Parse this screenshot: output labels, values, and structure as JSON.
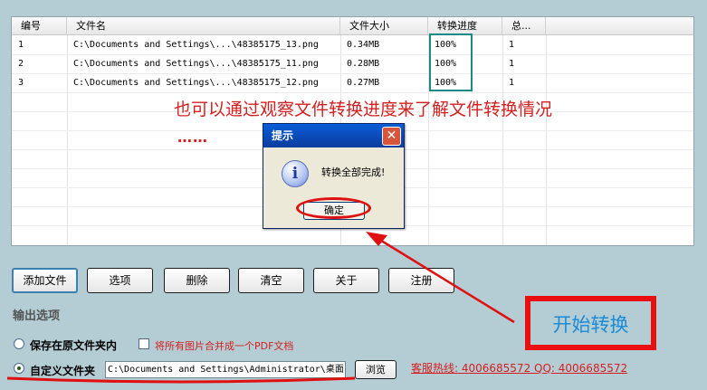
{
  "list": {
    "headers": [
      "编号",
      "文件名",
      "文件大小",
      "转换进度",
      "总..."
    ],
    "rows": [
      {
        "num": "1",
        "file": "C:\\Documents and Settings\\...\\48385175_13.png",
        "size": "0.34MB",
        "progress": "100%",
        "total": "1"
      },
      {
        "num": "2",
        "file": "C:\\Documents and Settings\\...\\48385175_11.png",
        "size": "0.28MB",
        "progress": "100%",
        "total": "1"
      },
      {
        "num": "3",
        "file": "C:\\Documents and Settings\\...\\48385175_12.png",
        "size": "0.27MB",
        "progress": "100%",
        "total": "1"
      }
    ]
  },
  "annotation": {
    "text": "也可以通过观察文件转换进度来了解文件转换情况",
    "dots": "……",
    "highlight_color": "#1a8a86",
    "ink_color": "#d42020"
  },
  "dialog": {
    "title": "提示",
    "close_glyph": "✕",
    "icon": "info-icon",
    "icon_glyph": "i",
    "message": "转换全部完成!",
    "ok_label": "确定"
  },
  "toolbar": {
    "add": "添加文件",
    "options": "选项",
    "delete": "删除",
    "clear": "清空",
    "about": "关于",
    "register": "注册"
  },
  "output": {
    "section_title": "输出选项",
    "save_original": "保存在原文件夹内",
    "merge_pdf": "将所有图片合并成一个PDF文档",
    "custom_folder": "自定义文件夹",
    "custom_path": "C:\\Documents and Settings\\Administrator\\桌面",
    "browse": "浏览",
    "selected": "custom_folder"
  },
  "hotline": "客服热线: 4006685572 QQ: 4006685572",
  "start": {
    "label": "开始转换"
  }
}
